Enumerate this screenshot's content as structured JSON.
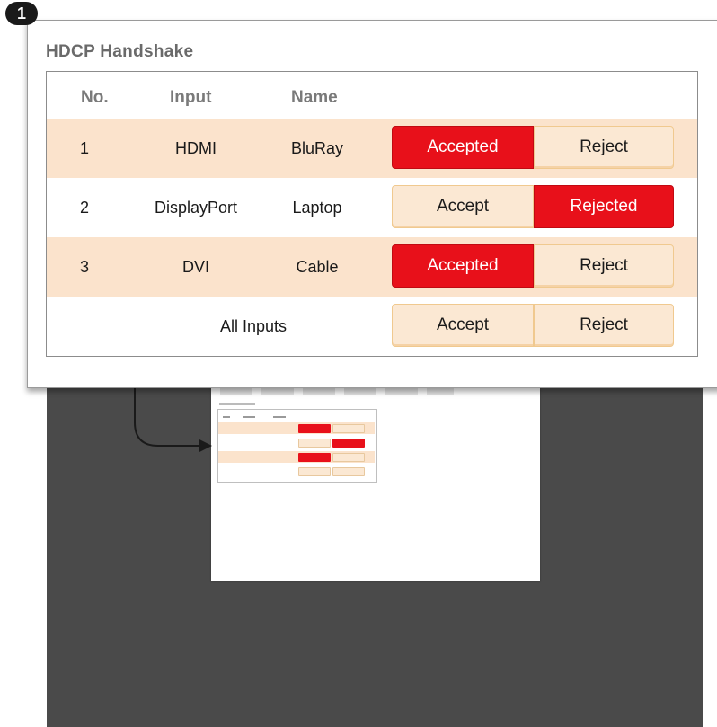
{
  "step_badge": "1",
  "dialog": {
    "title": "HDCP Handshake",
    "headers": {
      "no": "No.",
      "input": "Input",
      "name": "Name"
    },
    "rows": [
      {
        "no": "1",
        "input": "HDMI",
        "name": "BluRay",
        "accept_label": "Accepted",
        "reject_label": "Reject",
        "state": "accepted"
      },
      {
        "no": "2",
        "input": "DisplayPort",
        "name": "Laptop",
        "accept_label": "Accept",
        "reject_label": "Rejected",
        "state": "rejected"
      },
      {
        "no": "3",
        "input": "DVI",
        "name": "Cable",
        "accept_label": "Accepted",
        "reject_label": "Reject",
        "state": "accepted"
      }
    ],
    "all_inputs": {
      "label": "All Inputs",
      "accept_label": "Accept",
      "reject_label": "Reject"
    }
  },
  "colors": {
    "active_button": "#e8101a",
    "inactive_button": "#fbe8d3",
    "row_highlight": "#fbe3cc",
    "background_panel": "#4a4a4a"
  }
}
